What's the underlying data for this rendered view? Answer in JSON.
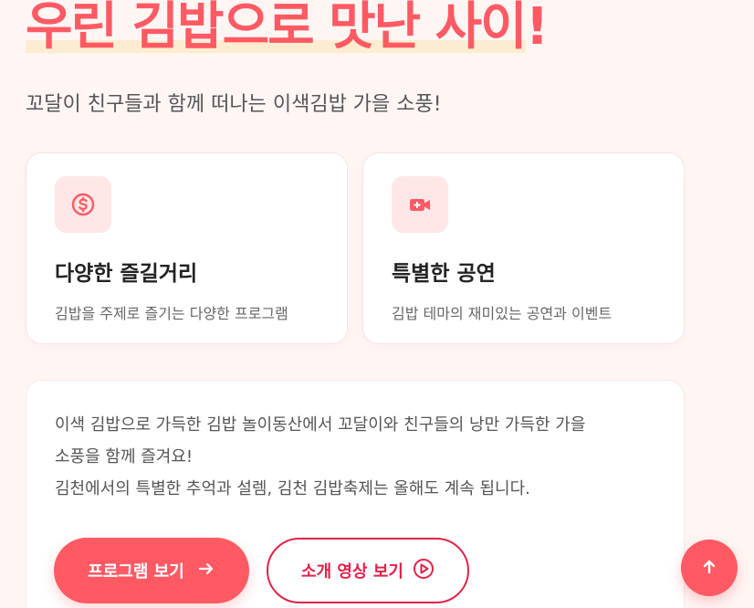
{
  "hero": {
    "headline": "우린 김밥으로 맛난 사이!",
    "subtitle": "꼬달이 친구들과 함께 떠나는 이색김밥 가을 소풍!"
  },
  "features": [
    {
      "icon": "dollar-coin-icon",
      "title": "다양한 즐길거리",
      "description": "김밥을 주제로 즐기는 다양한 프로그램"
    },
    {
      "icon": "video-camera-icon",
      "title": "특별한 공연",
      "description": "김밥 테마의 재미있는 공연과 이벤트"
    }
  ],
  "info": {
    "lines": [
      "이색 김밥으로 가득한 김밥 놀이동산에서 꼬달이와 친구들의 낭만 가득한 가을",
      "소풍을 함께 즐겨요!",
      "김천에서의 특별한 추억과 설렘, 김천 김밥축제는 올해도 계속 됩니다."
    ]
  },
  "actions": {
    "program_label": "프로그램 보기",
    "video_label": "소개 영상 보기"
  },
  "colors": {
    "accent": "#ff5a64",
    "outline": "#e0224a",
    "icon_bg": "#ffe7e7"
  }
}
